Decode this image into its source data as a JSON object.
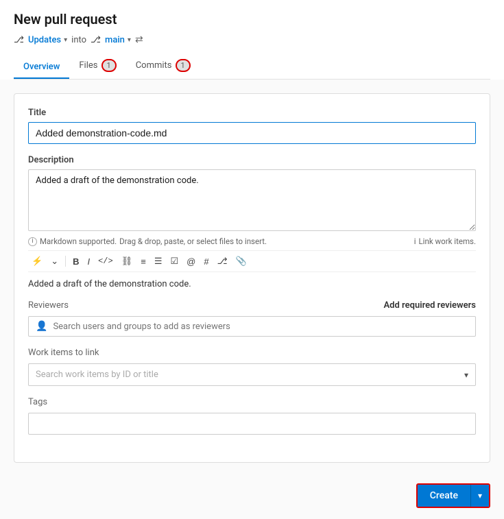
{
  "page": {
    "title": "New pull request"
  },
  "branch_bar": {
    "source_branch": "Updates",
    "into_text": "into",
    "target_branch": "main"
  },
  "tabs": [
    {
      "id": "overview",
      "label": "Overview",
      "badge": null,
      "active": true
    },
    {
      "id": "files",
      "label": "Files",
      "badge": "1",
      "active": false
    },
    {
      "id": "commits",
      "label": "Commits",
      "badge": "1",
      "active": false
    }
  ],
  "form": {
    "title_label": "Title",
    "title_value": "Added demonstration-code.md",
    "description_label": "Description",
    "description_value": "Added a draft of the demonstration code.",
    "markdown_info": "Markdown supported.",
    "drag_drop_text": "Drag & drop, paste, or select files to insert.",
    "link_work_text": "Link work items.",
    "preview_text": "Added a draft of the demonstration code.",
    "reviewers_label": "Reviewers",
    "add_required_label": "Add required reviewers",
    "reviewers_placeholder": "Search users and groups to add as reviewers",
    "work_items_label": "Work items to link",
    "work_items_placeholder": "Search work items by ID or title",
    "tags_label": "Tags",
    "tags_value": ""
  },
  "toolbar": {
    "buttons": [
      {
        "id": "lightning",
        "icon": "⚡",
        "label": "mention"
      },
      {
        "id": "chevron-down",
        "icon": "⌄",
        "label": "more"
      },
      {
        "id": "bold",
        "icon": "B",
        "label": "bold"
      },
      {
        "id": "italic",
        "icon": "I",
        "label": "italic"
      },
      {
        "id": "code",
        "icon": "</>",
        "label": "code"
      },
      {
        "id": "link",
        "icon": "🔗",
        "label": "link"
      },
      {
        "id": "ordered-list",
        "icon": "≡",
        "label": "ordered-list"
      },
      {
        "id": "unordered-list",
        "icon": "☰",
        "label": "unordered-list"
      },
      {
        "id": "task-list",
        "icon": "☑",
        "label": "task-list"
      },
      {
        "id": "mention",
        "icon": "@",
        "label": "at-mention"
      },
      {
        "id": "hash",
        "icon": "#",
        "label": "hash"
      },
      {
        "id": "pr",
        "icon": "⎇",
        "label": "pull-request"
      },
      {
        "id": "attach",
        "icon": "📎",
        "label": "attach"
      }
    ]
  },
  "footer": {
    "create_label": "Create",
    "create_dropdown_icon": "▾"
  }
}
